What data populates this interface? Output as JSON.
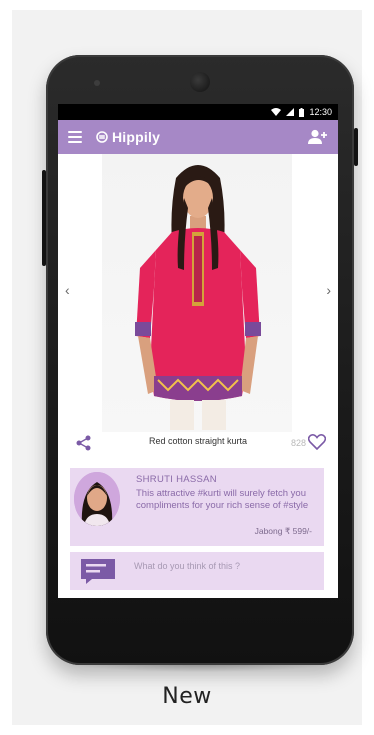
{
  "status_bar": {
    "time": "12:30"
  },
  "app_bar": {
    "title": "Hippily"
  },
  "product": {
    "name": "Red cotton straight kurta",
    "likes": "828"
  },
  "post": {
    "user_name": "SHRUTI HASSAN",
    "text": "This attractive #kurti will surely fetch you compliments for your rich sense of #style",
    "price": "Jabong ₹ 599/-"
  },
  "comment": {
    "placeholder": "What do you think of this ?"
  },
  "caption": "New",
  "colors": {
    "accent": "#a688c6",
    "card": "#ead9f1",
    "text_accent": "#8a6aa8"
  },
  "icons": [
    "menu-icon",
    "hippily-logo-icon",
    "add-user-icon",
    "chevron-left-icon",
    "chevron-right-icon",
    "share-icon",
    "heart-icon",
    "comment-icon",
    "wifi-icon",
    "signal-icon",
    "battery-icon"
  ]
}
